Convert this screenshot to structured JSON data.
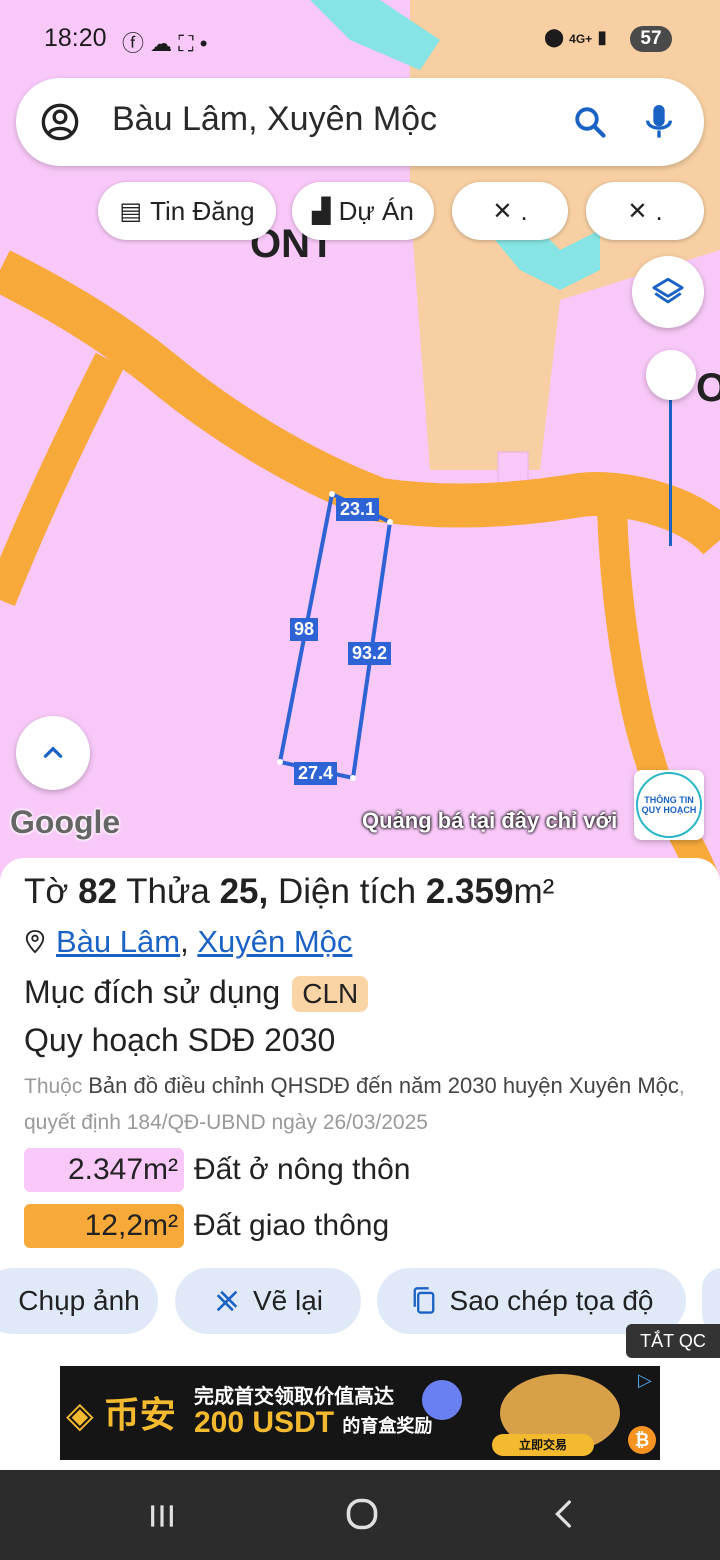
{
  "status": {
    "time": "18:20",
    "left_icons": "facebook-icon cloud-icon screenshot-icon dot",
    "network": "4G+",
    "battery": "57"
  },
  "search": {
    "query": "Bàu Lâm, Xuyên Mộc"
  },
  "chips": [
    {
      "label": "Tin Đăng"
    },
    {
      "label": "Dự Án"
    },
    {
      "label": "."
    },
    {
      "label": "."
    }
  ],
  "map": {
    "zone_label_1": "ONT",
    "zone_label_2": "ON",
    "edge_top": "23.1",
    "edge_left": "98",
    "edge_right": "93.2",
    "edge_bottom": "27.4",
    "google": "Google",
    "promo": "Quảng bá tại đây chỉ với",
    "info_badge_line1": "THÔNG TIN",
    "info_badge_line2": "QUY HOẠCH"
  },
  "parcel": {
    "to_label": "Tờ",
    "to": "82",
    "thua_label": "Thửa",
    "thua": "25,",
    "area_label": "Diện tích",
    "area": "2.359",
    "area_unit": "m²",
    "commune": "Bàu Lâm",
    "comma": ",",
    "district": "Xuyên Mộc",
    "purpose_label": "Mục đích sử dụng",
    "purpose_code": "CLN",
    "plan_title": "Quy hoạch SDĐ 2030",
    "source_prefix": "Thuộc",
    "source_map": "Bản đồ điều chỉnh QHSDĐ đến năm 2030 huyện Xuyên Mộc",
    "source_decision": ", quyết định 184/QĐ-UBND ngày 26/03/2025",
    "zones": [
      {
        "area": "2.347m²",
        "label": "Đất ở nông thôn",
        "color": "#f8c8f8"
      },
      {
        "area": "12,2m²",
        "label": "Đất giao thông",
        "color": "#f7a93a"
      }
    ]
  },
  "actions": [
    {
      "label": "Chụp ảnh"
    },
    {
      "label": "Vẽ lại"
    },
    {
      "label": "Sao chép tọa độ"
    }
  ],
  "ad": {
    "close_label": "TẮT QC",
    "brand": "币安",
    "line1": "完成首交领取价值高达",
    "line2": "200 USDT",
    "line2_suffix": "的育盒奖励",
    "cta": "立即交易"
  },
  "colors": {
    "map_rural_residential": "#f8c8f8",
    "map_road": "#f7a93a",
    "map_water": "#86e4e4",
    "parcel_outline": "#2e63d6",
    "link": "#1a62c4"
  }
}
